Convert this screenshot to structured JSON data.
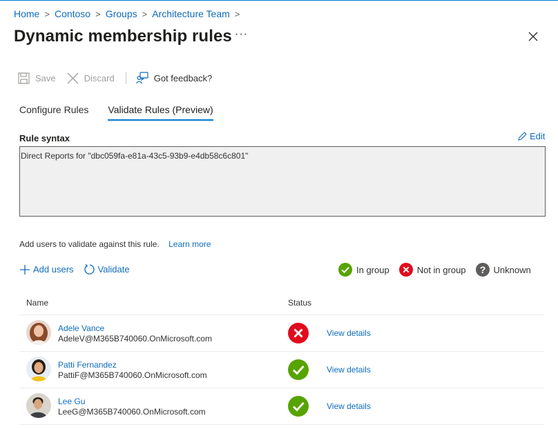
{
  "breadcrumb": [
    "Home",
    "Contoso",
    "Groups",
    "Architecture Team"
  ],
  "page_title": "Dynamic membership rules",
  "more_label": "···",
  "commands": {
    "save": "Save",
    "discard": "Discard",
    "feedback": "Got feedback?"
  },
  "tabs": [
    "Configure Rules",
    "Validate Rules (Preview)"
  ],
  "rule": {
    "label": "Rule syntax",
    "edit": "Edit",
    "text": "Direct Reports for \"dbc059fa-e81a-43c5-93b9-e4db58c6c801\""
  },
  "help": {
    "text": "Add users to validate against this rule.",
    "link": "Learn more"
  },
  "actions": {
    "add_users": "Add users",
    "validate": "Validate"
  },
  "legend": {
    "in_group": "In group",
    "not_in_group": "Not in group",
    "unknown": "Unknown"
  },
  "table": {
    "headers": [
      "Name",
      "Status"
    ],
    "rows": [
      {
        "name": "Adele Vance",
        "email": "AdeleV@M365B740060.OnMicrosoft.com",
        "status": "Not in group",
        "details": "View details"
      },
      {
        "name": "Patti Fernandez",
        "email": "PattiF@M365B740060.OnMicrosoft.com",
        "status": "In group",
        "details": "View details"
      },
      {
        "name": "Lee Gu",
        "email": "LeeG@M365B740060.OnMicrosoft.com",
        "status": "In group",
        "details": "View details"
      }
    ]
  },
  "colors": {
    "accent": "#0078d4",
    "link": "#0f6cbd",
    "success": "#57a300",
    "error": "#e00b1c",
    "unknown": "#605e5c"
  },
  "icons": [
    "chevron-right-icon",
    "close-icon",
    "save-icon",
    "discard-icon",
    "feedback-icon",
    "edit-icon",
    "add-icon",
    "refresh-icon",
    "check-circle-icon",
    "error-circle-icon",
    "question-circle-icon"
  ]
}
